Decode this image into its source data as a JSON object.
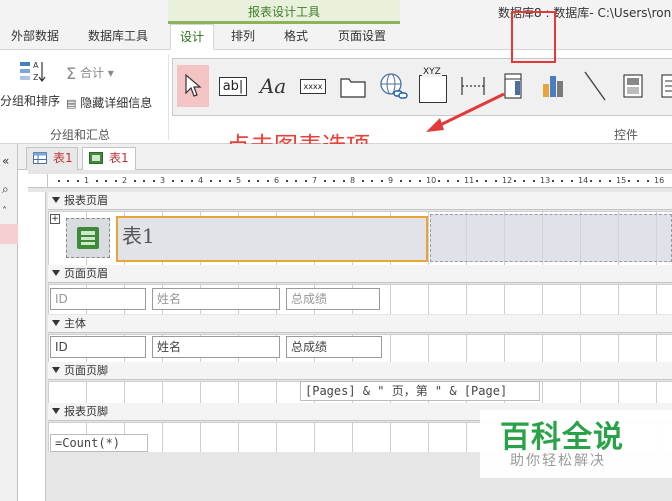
{
  "ribbon": {
    "context_label": "报表设计工具",
    "window_title": "数据库8 : 数据库- C:\\Users\\ron",
    "tabs": [
      {
        "label": "外部数据"
      },
      {
        "label": "数据库工具"
      },
      {
        "label": "设计",
        "active": true
      },
      {
        "label": "排列"
      },
      {
        "label": "格式"
      },
      {
        "label": "页面设置"
      }
    ],
    "group_sort": {
      "sort_label": "分组和排序",
      "sum_label": "合计",
      "hide_label": "隐藏详细信息",
      "group_label": "分组和汇总"
    },
    "controls": {
      "group_label": "控件",
      "items": [
        {
          "name": "select",
          "icon": "pointer-icon"
        },
        {
          "name": "textbox",
          "text": "ab|",
          "icon": "textbox-icon"
        },
        {
          "name": "label",
          "text": "Aa",
          "icon": "label-icon"
        },
        {
          "name": "button",
          "text": "xxxx",
          "icon": "button-icon"
        },
        {
          "name": "tab-control",
          "icon": "folder-tab-icon"
        },
        {
          "name": "hyperlink",
          "icon": "globe-link-icon"
        },
        {
          "name": "option-group",
          "text": "XYZ",
          "icon": "option-group-icon"
        },
        {
          "name": "page-break",
          "icon": "page-break-icon"
        },
        {
          "name": "combo",
          "icon": "combo-box-icon"
        },
        {
          "name": "chart",
          "icon": "bar-chart-icon"
        },
        {
          "name": "line",
          "icon": "line-icon"
        },
        {
          "name": "toggle",
          "icon": "toggle-button-icon"
        },
        {
          "name": "list",
          "icon": "list-box-icon"
        }
      ]
    }
  },
  "annotation": {
    "text": "点击图表选项",
    "color": "#e8423a"
  },
  "doc_tabs": [
    {
      "label": "表1"
    },
    {
      "label": "表1",
      "active": true
    }
  ],
  "ruler": {
    "ticks": [
      "1",
      "2",
      "3",
      "4",
      "5",
      "6",
      "7",
      "8",
      "9",
      "10",
      "11",
      "12",
      "13",
      "14",
      "15",
      "16"
    ]
  },
  "sections": {
    "report_header": "报表页眉",
    "page_header": "页面页眉",
    "detail": "主体",
    "page_footer": "页面页脚",
    "report_footer": "报表页脚"
  },
  "report": {
    "title": "表1",
    "page_header_fields": [
      "ID",
      "姓名",
      "总成绩"
    ],
    "detail_fields": [
      "ID",
      "姓名",
      "总成绩"
    ],
    "page_footer_expr": "[Pages] & \" 页，第 \" & [Page]",
    "report_footer_expr": "=Count(*)"
  },
  "watermark": {
    "big": "百科全说",
    "small": "助你轻松解决"
  },
  "colors": {
    "accent_green": "#3f7d2a",
    "highlight_red": "#e23a3a",
    "selection_orange": "#e8a33a",
    "watermark_green": "#2aa24a"
  }
}
